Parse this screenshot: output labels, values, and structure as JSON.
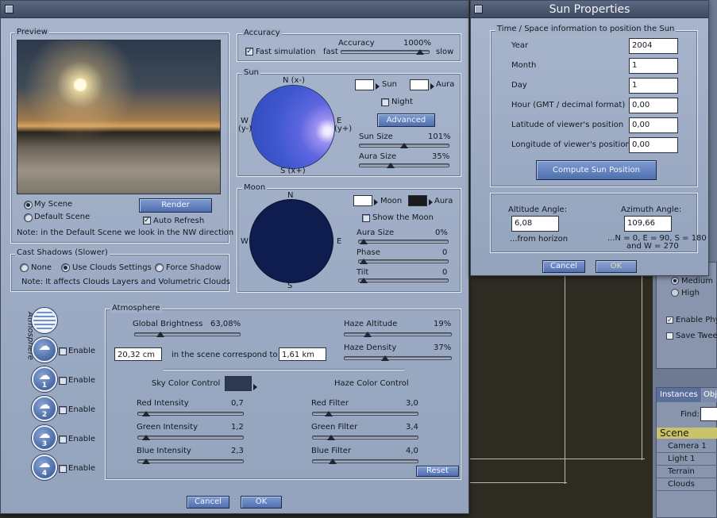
{
  "background": {
    "right_panel": {
      "tab_instances": "Instances",
      "tab_obj": "Obj",
      "find_label": "Find:",
      "scene_header": "Scene",
      "scene_items": [
        "Camera 1",
        "Light 1",
        "Terrain",
        "Clouds"
      ],
      "medium_label": "Medium",
      "high_label": "High",
      "enable_phy_label": "Enable Phy",
      "save_twee_label": "Save Twee"
    }
  },
  "main_dialog": {
    "preview": {
      "title": "Preview",
      "my_scene_label": "My Scene",
      "default_scene_label": "Default Scene",
      "render_label": "Render",
      "auto_refresh_label": "Auto Refresh",
      "auto_refresh_checked": true,
      "note": "Note: in the Default Scene we look in the NW direction"
    },
    "cast_shadows": {
      "title": "Cast Shadows (Slower)",
      "none_label": "None",
      "use_clouds_label": "Use Clouds Settings",
      "force_shadow_label": "Force Shadow",
      "note": "Note: It affects Clouds Layers and Volumetric Clouds"
    },
    "accuracy": {
      "title": "Accuracy",
      "fast_sim_label": "Fast simulation",
      "fast_sim_checked": true,
      "accuracy_label": "Accuracy",
      "accuracy_value": "1000%",
      "accuracy_level": 0.95,
      "fast_label": "fast",
      "slow_label": "slow"
    },
    "sun": {
      "title": "Sun",
      "compass_n": "N (x-)",
      "compass_s": "S (x+)",
      "compass_w": "W",
      "compass_w2": "(y-)",
      "compass_e": "E",
      "compass_e2": "(y+)",
      "sun_color_label": "Sun",
      "aura_color_label": "Aura",
      "night_label": "Night",
      "advanced_label": "Advanced",
      "sun_size_label": "Sun Size",
      "sun_size_value": "101%",
      "sun_size_level": 0.5,
      "aura_size_label": "Aura Size",
      "aura_size_value": "35%",
      "aura_size_level": 0.33
    },
    "moon": {
      "title": "Moon",
      "compass_n": "N",
      "compass_s": "S",
      "compass_w": "W",
      "compass_e": "E",
      "moon_color_label": "Moon",
      "aura_color_label": "Aura",
      "show_moon_label": "Show the Moon",
      "aura_size_label": "Aura Size",
      "aura_size_value": "0%",
      "aura_size_level": 0.0,
      "phase_label": "Phase",
      "phase_value": "0",
      "phase_level": 0.0,
      "tilt_label": "Tilt",
      "tilt_value": "0",
      "tilt_level": 0.0
    },
    "side_tabs": {
      "atmosphere_label": "Atmosphere",
      "enable_label": "Enable",
      "icon_numbers": [
        "1",
        "2",
        "3",
        "4"
      ]
    },
    "atmosphere": {
      "title": "Atmosphere",
      "global_brightness_label": "Global Brightness",
      "global_brightness_value": "63,08%",
      "global_brightness_level": 0.22,
      "haze_altitude_label": "Haze Altitude",
      "haze_altitude_value": "19%",
      "haze_altitude_level": 0.19,
      "haze_density_label": "Haze Density",
      "haze_density_value": "37%",
      "haze_density_level": 0.37,
      "scale_value": "20,32 cm",
      "scale_text": "in the scene correspond to",
      "scale_km": "1,61 km",
      "sky_color_label": "Sky Color Control",
      "haze_color_label": "Haze Color Control",
      "red_intensity_label": "Red Intensity",
      "red_intensity_value": "0,7",
      "red_intensity_level": 0.03,
      "green_intensity_label": "Green Intensity",
      "green_intensity_value": "1,2",
      "green_intensity_level": 0.03,
      "blue_intensity_label": "Blue Intensity",
      "blue_intensity_value": "2,3",
      "blue_intensity_level": 0.03,
      "red_filter_label": "Red Filter",
      "red_filter_value": "3,0",
      "red_filter_level": 0.12,
      "green_filter_label": "Green Filter",
      "green_filter_value": "3,4",
      "green_filter_level": 0.14,
      "blue_filter_label": "Blue Filter",
      "blue_filter_value": "4,0",
      "blue_filter_level": 0.16,
      "reset_label": "Reset"
    },
    "cancel_label": "Cancel",
    "ok_label": "OK"
  },
  "sun_properties": {
    "title": "Sun Properties",
    "group_title": "Time / Space information to position the Sun",
    "fields": [
      {
        "label": "Year",
        "value": "2004"
      },
      {
        "label": "Month",
        "value": "1"
      },
      {
        "label": "Day",
        "value": "1"
      },
      {
        "label": "Hour (GMT / decimal format)",
        "value": "0,00"
      },
      {
        "label": "Latitude of viewer's position",
        "value": "0,00"
      },
      {
        "label": "Longitude of viewer's position",
        "value": "0,00"
      }
    ],
    "compute_label": "Compute Sun Position",
    "altitude_label": "Altitude Angle:",
    "altitude_value": "6,08",
    "altitude_note": "...from horizon",
    "azimuth_label": "Azimuth Angle:",
    "azimuth_value": "109,66",
    "azimuth_note1": "...N = 0, E = 90, S = 180",
    "azimuth_note2": "and W = 270",
    "cancel_label": "Cancel",
    "ok_label": "OK"
  },
  "colors": {
    "sun_color": "#ffffff",
    "sun_aura_color": "#ffffff",
    "moon_color": "#ffffff",
    "moon_aura_color": "#1a1a1a",
    "sky_color": "#2b3a52"
  }
}
